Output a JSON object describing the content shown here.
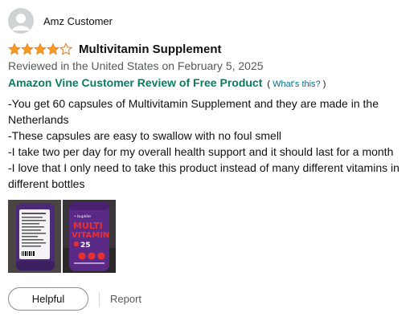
{
  "review": {
    "profile_name": "Amz Customer",
    "rating_stars": 4,
    "rating_max": 5,
    "title": "Multivitamin Supplement",
    "date_text": "Reviewed in the United States on February 5, 2025",
    "vine_label": "Amazon Vine Customer Review of Free Product",
    "whats_this_open": "(",
    "whats_this_label": "What's this?",
    "whats_this_close": ")",
    "body": [
      "-You get 60 capsules of Multivitamin Supplement and they are made in the Netherlands",
      "-These capsules are easy to swallow with no foul smell",
      "-I take two per day for my overall health support and it should last for a month",
      "-I love that I only need to take this product instead of many different vitamins in different bottles"
    ],
    "images": [
      {
        "alt": "bottle-back-label-photo"
      },
      {
        "alt": "bottle-front-photo"
      }
    ],
    "bottle_text": {
      "brand": "• bupkite",
      "line1": "MULTI",
      "line2": "VITAMIN",
      "number": "25"
    }
  },
  "actions": {
    "helpful_label": "Helpful",
    "report_label": "Report"
  },
  "colors": {
    "star": "#f79a1e",
    "vine_green": "#067d62",
    "link": "#007185",
    "muted_text": "#565959",
    "bottle_purple": "#5b2a86",
    "bottle_accent": "#e8312f"
  }
}
